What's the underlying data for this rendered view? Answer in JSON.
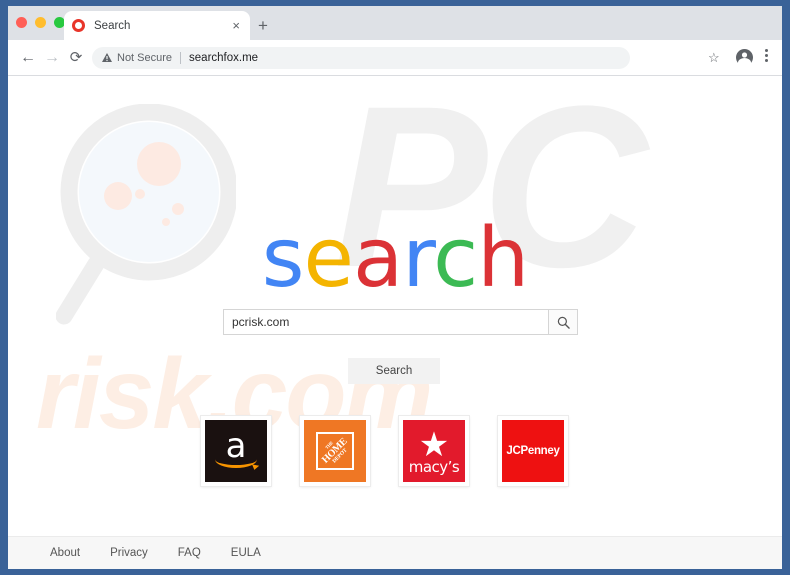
{
  "window": {
    "traffic_lights": [
      "close",
      "minimize",
      "maximize"
    ]
  },
  "tab_strip": {
    "active_tab": {
      "title": "Search",
      "favicon": "red-ring-icon",
      "close_label": "×"
    },
    "new_tab_label": "+"
  },
  "toolbar": {
    "back_icon": "←",
    "forward_icon": "→",
    "reload_icon": "⟳",
    "security_icon": "warning-triangle-icon",
    "security_text": "Not Secure",
    "url": "searchfox.me",
    "bookmark_icon": "☆",
    "profile_icon": "account-circle-icon",
    "menu_icon": "three-dot-menu-icon"
  },
  "page": {
    "logo": {
      "letters": [
        {
          "char": "s",
          "color": "#4285f4"
        },
        {
          "char": "e",
          "color": "#f4b400"
        },
        {
          "char": "a",
          "color": "#db3236"
        },
        {
          "char": "r",
          "color": "#4285f4"
        },
        {
          "char": "c",
          "color": "#3cba54"
        },
        {
          "char": "h",
          "color": "#db3236"
        }
      ],
      "text": "search"
    },
    "search": {
      "value": "pcrisk.com",
      "placeholder": "",
      "icon_button_label": "search-magnifier-icon",
      "submit_label": "Search"
    },
    "watermarks": {
      "pc": "PC",
      "risk": "risk.com",
      "magnifier": "magnifier-watermark"
    },
    "shortcuts": [
      {
        "name": "amazon",
        "label": "a",
        "bg": "#1a1110"
      },
      {
        "name": "home-depot",
        "line1": "THE",
        "line2": "HOME",
        "line3": "DEPOT",
        "bg": "#ef7724"
      },
      {
        "name": "macys",
        "label": "macy’s",
        "bg": "#e21a2c"
      },
      {
        "name": "jcpenney",
        "label": "JCPenney",
        "bg": "#ee1111"
      }
    ],
    "footer_links": [
      "About",
      "Privacy",
      "FAQ",
      "EULA"
    ]
  },
  "colors": {
    "frame_blue": "#3a6298",
    "tab_bar": "#dee1e6",
    "omnibox": "#f1f3f4",
    "watermark_gray": "#f0f0f0",
    "watermark_peach": "#fdeee4"
  }
}
